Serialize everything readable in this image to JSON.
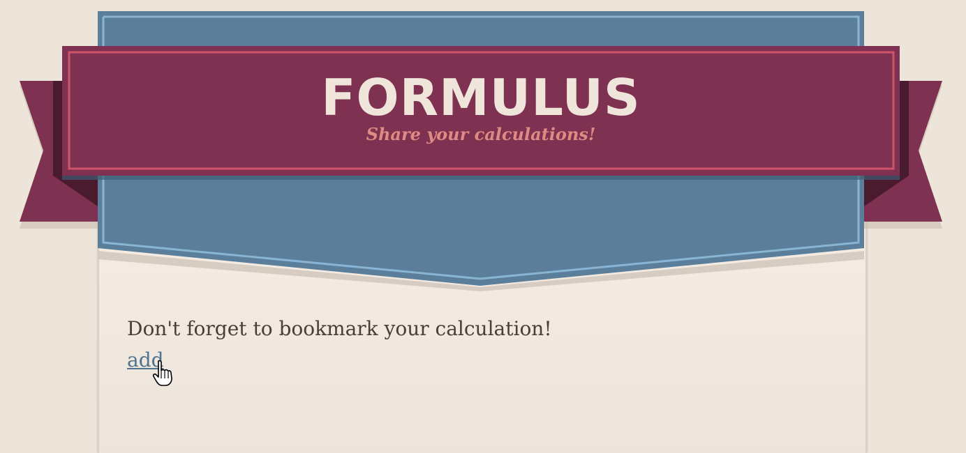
{
  "header": {
    "title": "FORMULUS",
    "subtitle": "Share your calculations!"
  },
  "content": {
    "message": "Don't forget to bookmark your calculation!",
    "add_link": "add"
  },
  "colors": {
    "background": "#ede4da",
    "banner_blue": "#5b7f9a",
    "ribbon_maroon": "#7e3150",
    "ribbon_border": "#cf5468",
    "title_text": "#efe5db",
    "subtitle_text": "#de8b83",
    "link": "#4f7390"
  }
}
